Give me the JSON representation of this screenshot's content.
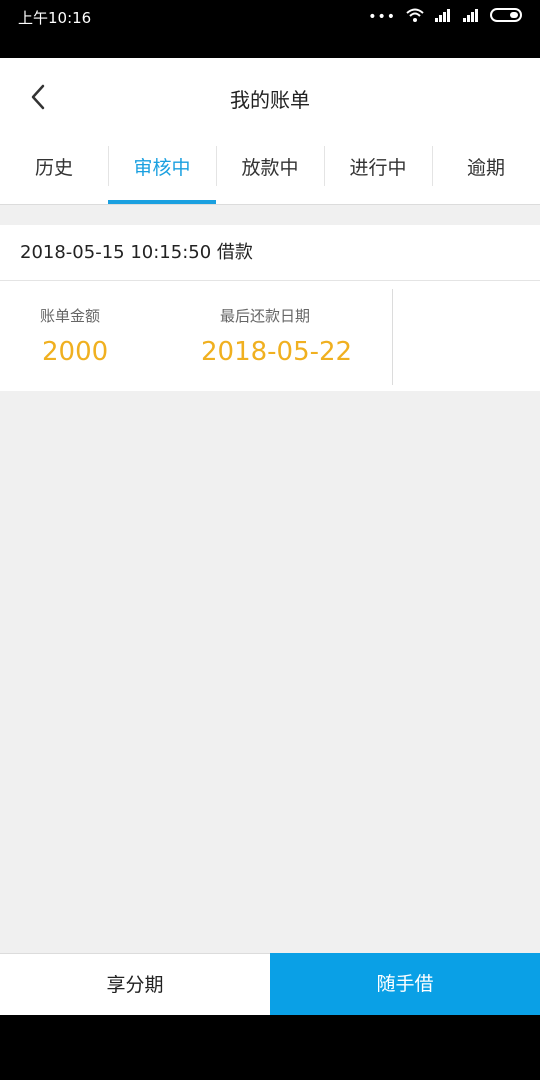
{
  "status_bar": {
    "time": "上午10:16"
  },
  "header": {
    "title": "我的账单"
  },
  "tabs": [
    {
      "label": "历史"
    },
    {
      "label": "审核中",
      "active": true
    },
    {
      "label": "放款中"
    },
    {
      "label": "进行中"
    },
    {
      "label": "逾期"
    }
  ],
  "bill": {
    "header": "2018-05-15 10:15:50 借款",
    "amount_label": "账单金额",
    "amount_value": "2000",
    "due_label": "最后还款日期",
    "due_value": "2018-05-22"
  },
  "footer": {
    "left_label": "享分期",
    "right_label": "随手借"
  },
  "colors": {
    "accent": "#1aa0e0",
    "amount": "#f0b020",
    "primary_button": "#0aa0e6"
  }
}
